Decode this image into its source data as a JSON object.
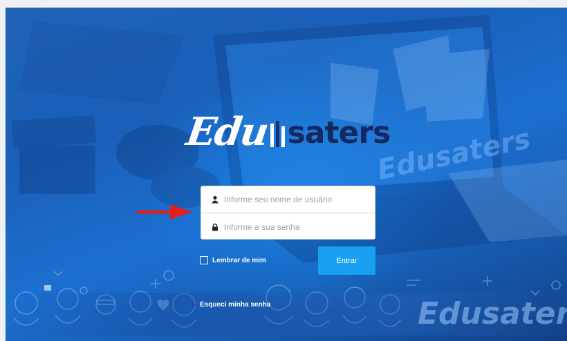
{
  "brand": {
    "logo_script": "Edu",
    "logo_bold": "saters",
    "watermark_script": "Edu",
    "watermark_bold": "saters",
    "colors": {
      "primary_dark": "#14295f",
      "accent": "#1aa0f2",
      "background": "#1c6fd0",
      "annotation_arrow": "#e0201e"
    }
  },
  "login": {
    "username_placeholder": "Informe seu nome de usuário",
    "password_placeholder": "Informe a sua senha",
    "username_icon": "user-icon",
    "password_icon": "lock-icon",
    "remember_label": "Lembrar de mim",
    "submit_label": "Entrar",
    "forgot_label": "Esqueci minha senha"
  },
  "annotation": {
    "icon": "red-arrow-icon"
  }
}
